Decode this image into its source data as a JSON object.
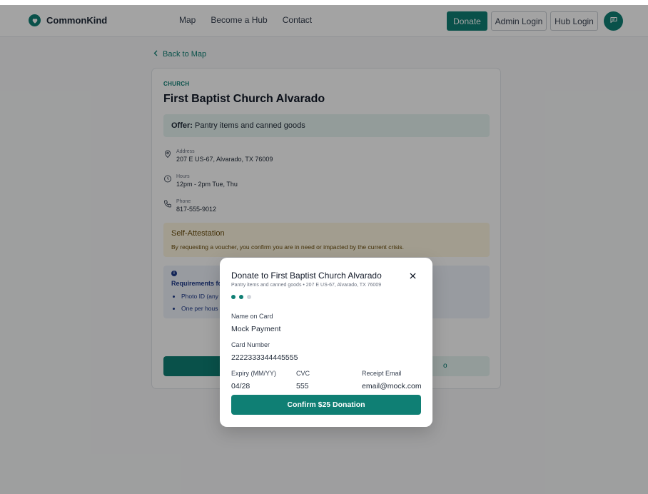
{
  "app": {
    "name": "CommonKind"
  },
  "nav": {
    "map": "Map",
    "become_hub": "Become a Hub",
    "contact": "Contact"
  },
  "header": {
    "donate": "Donate",
    "admin_login": "Admin Login",
    "hub_login": "Hub Login"
  },
  "back": {
    "label": "Back to Map"
  },
  "hub": {
    "category": "CHURCH",
    "name": "First Baptist Church Alvarado",
    "offer_label": "Offer:",
    "offer_text": "Pantry items and canned goods",
    "address_label": "Address",
    "address": "207 E US-67, Alvarado, TX 76009",
    "hours_label": "Hours",
    "hours": "12pm - 2pm Tue, Thu",
    "phone_label": "Phone",
    "phone": "817-555-9012"
  },
  "attestation": {
    "title": "Self-Attestation",
    "text": "By requesting a voucher, you confirm you are in need or impacted by the current crisis."
  },
  "requirements": {
    "title": "Requirements fo",
    "items": [
      "Photo ID (any",
      "One per hous"
    ]
  },
  "secondary_action": {
    "label": "o"
  },
  "modal": {
    "title": "Donate to First Baptist Church Alvarado",
    "subtitle": "Pantry items and canned goods • 207 E US-67, Alvarado, TX 76009",
    "steps": {
      "total": 3,
      "current": 2
    },
    "name_label": "Name on Card",
    "name_value": "Mock Payment",
    "card_label": "Card Number",
    "card_value": "2222333344445555",
    "expiry_label": "Expiry (MM/YY)",
    "expiry_value": "04/28",
    "cvc_label": "CVC",
    "cvc_value": "555",
    "email_label": "Receipt Email",
    "email_value": "email@mock.com",
    "confirm_label": "Confirm $25 Donation"
  },
  "colors": {
    "brand": "#0f7f74",
    "offer_bg": "#e6f4f1",
    "attest_bg": "#fdf6e0",
    "req_bg": "#eef2fb"
  },
  "icons": [
    "heart-icon",
    "chat-icon",
    "chevron-left-icon",
    "location-pin-icon",
    "clock-icon",
    "phone-icon",
    "info-icon",
    "close-icon"
  ]
}
